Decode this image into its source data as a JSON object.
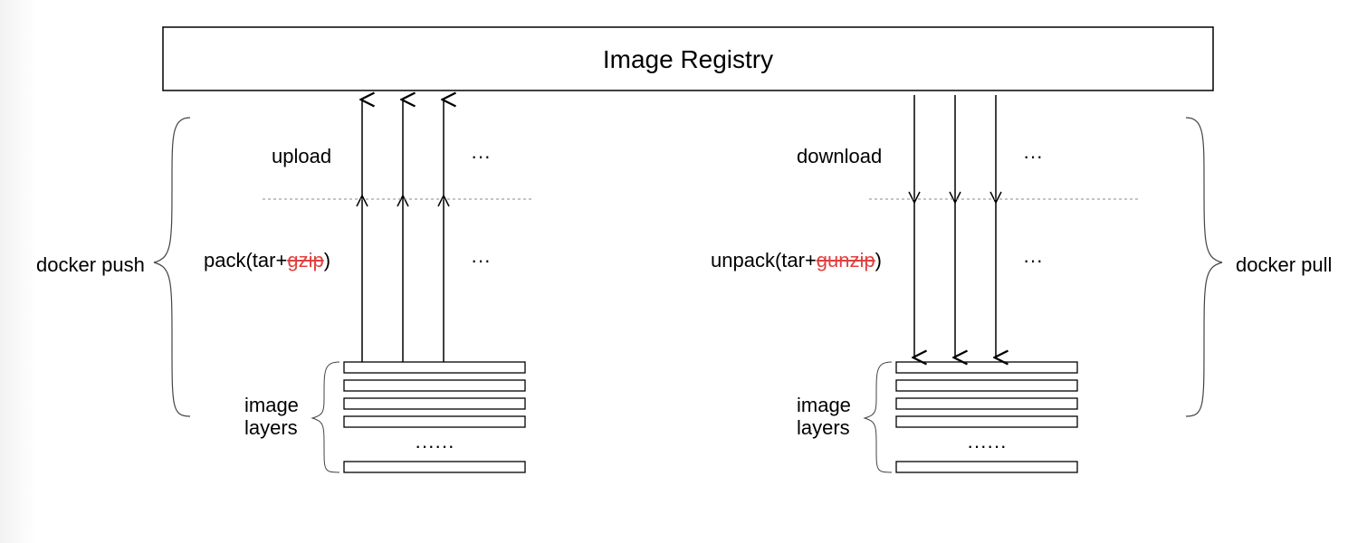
{
  "registry": {
    "title": "Image Registry"
  },
  "left": {
    "groupLabel": "docker push",
    "step1": "upload",
    "step2_prefix": "pack(tar+",
    "step2_strike": "gzip",
    "step2_suffix": ")",
    "dots": "···",
    "layersLabel1": "image",
    "layersLabel2": "layers",
    "ellipsis": "······"
  },
  "right": {
    "groupLabel": "docker pull",
    "step1": "download",
    "step2_prefix": "unpack(tar+",
    "step2_strike": "gunzip",
    "step2_suffix": ")",
    "dots": "···",
    "layersLabel1": "image",
    "layersLabel2": "layers",
    "ellipsis": "······"
  }
}
